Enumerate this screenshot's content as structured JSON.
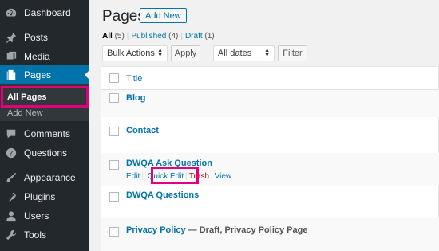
{
  "sidebar": {
    "items": [
      {
        "label": "Dashboard",
        "icon": "dashboard-icon"
      },
      {
        "label": "Posts",
        "icon": "pin-icon"
      },
      {
        "label": "Media",
        "icon": "media-icon"
      },
      {
        "label": "Pages",
        "icon": "pages-icon"
      },
      {
        "label": "Comments",
        "icon": "comment-icon"
      },
      {
        "label": "Questions",
        "icon": "question-icon"
      },
      {
        "label": "Appearance",
        "icon": "brush-icon"
      },
      {
        "label": "Plugins",
        "icon": "plugin-icon"
      },
      {
        "label": "Users",
        "icon": "user-icon"
      },
      {
        "label": "Tools",
        "icon": "wrench-icon"
      }
    ],
    "submenu": [
      {
        "label": "All Pages"
      },
      {
        "label": "Add New"
      }
    ],
    "active_color": "#0073aa",
    "highlight_color": "#e3007b"
  },
  "header": {
    "title": "Pages",
    "add_new_label": "Add New"
  },
  "filters": {
    "all_label": "All",
    "all_count": "(5)",
    "published_label": "Published",
    "published_count": "(4)",
    "draft_label": "Draft",
    "draft_count": "(1)",
    "bulk_actions": "Bulk Actions",
    "apply_label": "Apply",
    "all_dates": "All dates",
    "filter_label": "Filter"
  },
  "table": {
    "column_title": "Title",
    "rows": [
      {
        "title": "Blog"
      },
      {
        "title": "Contact"
      },
      {
        "title": "DWQA Ask Question"
      },
      {
        "title": "DWQA Questions"
      },
      {
        "title": "Privacy Policy",
        "state": "— Draft, Privacy Policy Page"
      }
    ],
    "row_actions": {
      "edit": "Edit",
      "quick_edit": "Quick Edit",
      "trash": "Trash",
      "view": "View"
    }
  }
}
